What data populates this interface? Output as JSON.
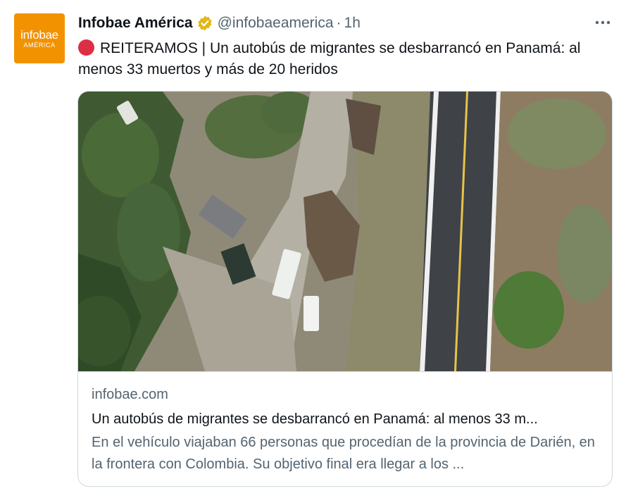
{
  "author": {
    "avatar_line1": "infobae",
    "avatar_line2": "AMÉRICA",
    "name": "Infobae América",
    "handle": "@infobaeamerica",
    "separator": "·",
    "time": "1h",
    "verified_color": "#e2b719"
  },
  "tweet": {
    "text": "REITERAMOS | Un autobús de migrantes se desbarrancó en Panamá: al menos 33 muertos y más de 20 heridos",
    "emoji": "red-circle"
  },
  "card": {
    "image_alt": "Aerial view of bus crash site beside a road",
    "domain": "infobae.com",
    "title": "Un autobús de migrantes se desbarrancó en Panamá: al menos 33 m...",
    "description": "En el vehículo viajaban 66 personas que procedían de la provincia de Darién, en la frontera con Colombia. Su objetivo final era llegar a los ..."
  },
  "colors": {
    "brand_orange": "#f39200",
    "secondary_text": "#536471",
    "primary_text": "#0f1419",
    "border": "#cfd9de"
  }
}
